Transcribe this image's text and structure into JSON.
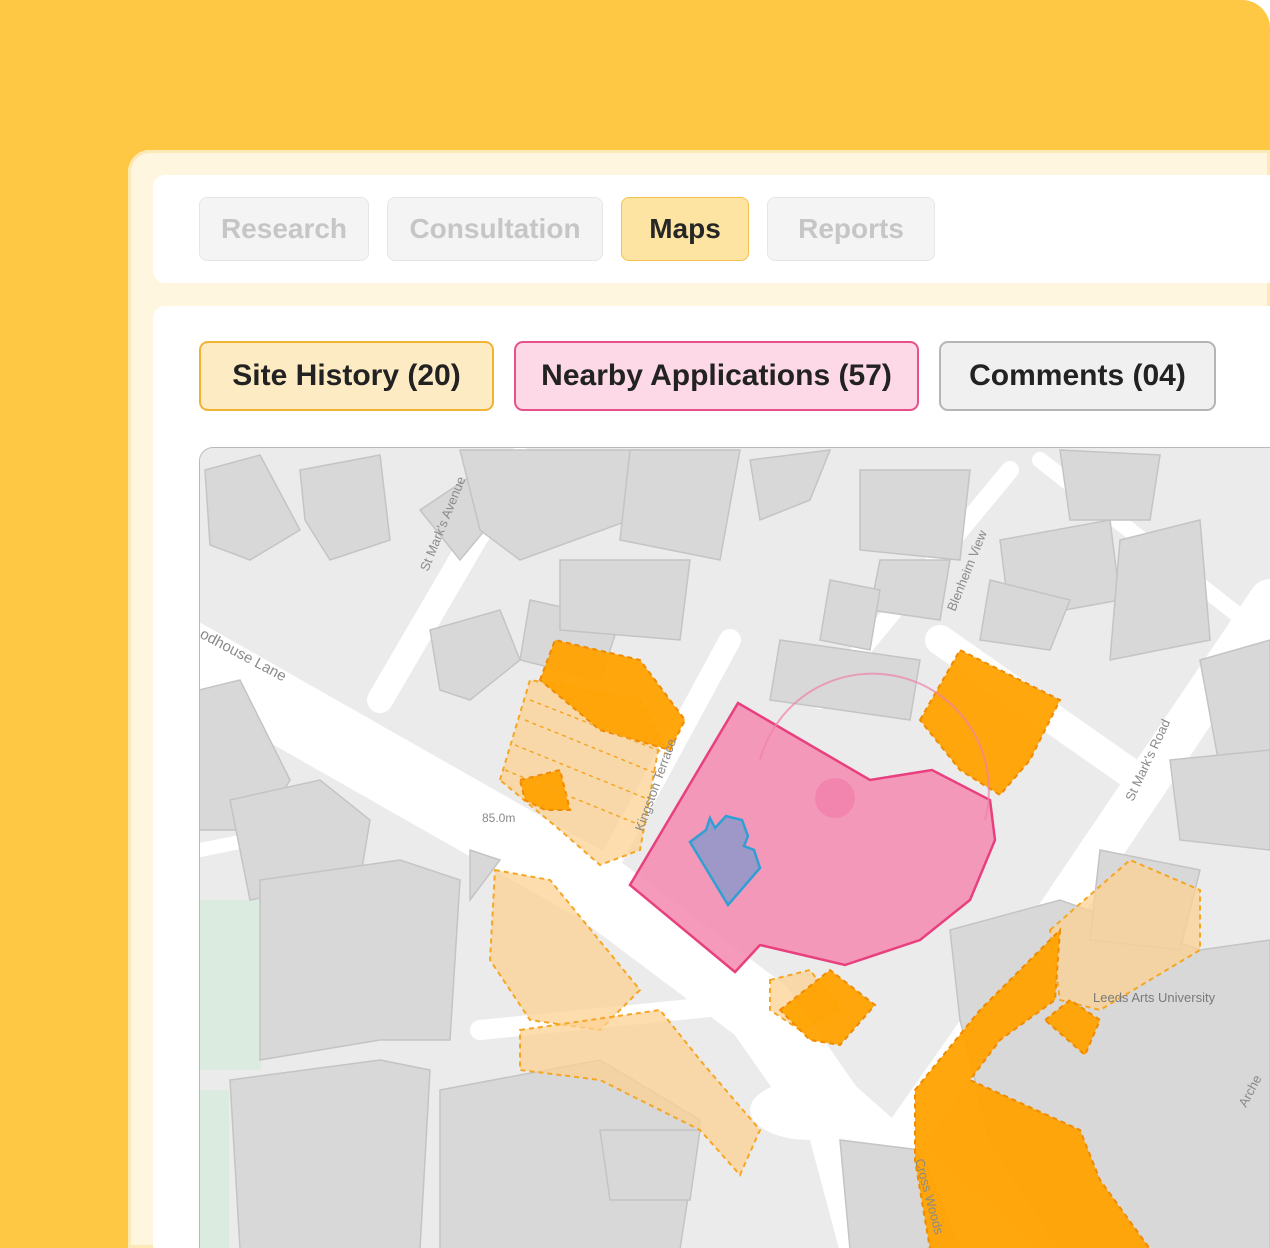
{
  "tabs": [
    {
      "label": "Research",
      "active": false
    },
    {
      "label": "Consultation",
      "active": false
    },
    {
      "label": "Maps",
      "active": true
    },
    {
      "label": "Reports",
      "active": false
    }
  ],
  "filters": [
    {
      "label": "Site History (20)",
      "color": "#fdebc4",
      "border": "#f2b233"
    },
    {
      "label": "Nearby Applications (57)",
      "color": "#fdd8e6",
      "border": "#e8508a"
    },
    {
      "label": "Comments (04)",
      "color": "#f0f0f0",
      "border": "#b5b5b5"
    }
  ],
  "map": {
    "streets": {
      "st_marks_avenue": "St Mark's Avenue",
      "woodhouse_lane": "odhouse Lane",
      "kingston_terrace": "Kingston Terrace",
      "blenheim_view": "Blenheim View",
      "st_marks_road": "St Mark's Road",
      "cross_woodstock": "Cross Woods",
      "archery": "Arche"
    },
    "places": {
      "leeds_arts_university": "Leeds Arts University"
    },
    "elevation_label": "85.0m",
    "colors": {
      "site_pink": "#f58fb5",
      "site_pink_stroke": "#e8407f",
      "focus_blue": "#9e98c8",
      "focus_blue_stroke": "#2f9fd4",
      "history_orange": "#ffa200",
      "history_orange_light": "#fcd193"
    }
  }
}
